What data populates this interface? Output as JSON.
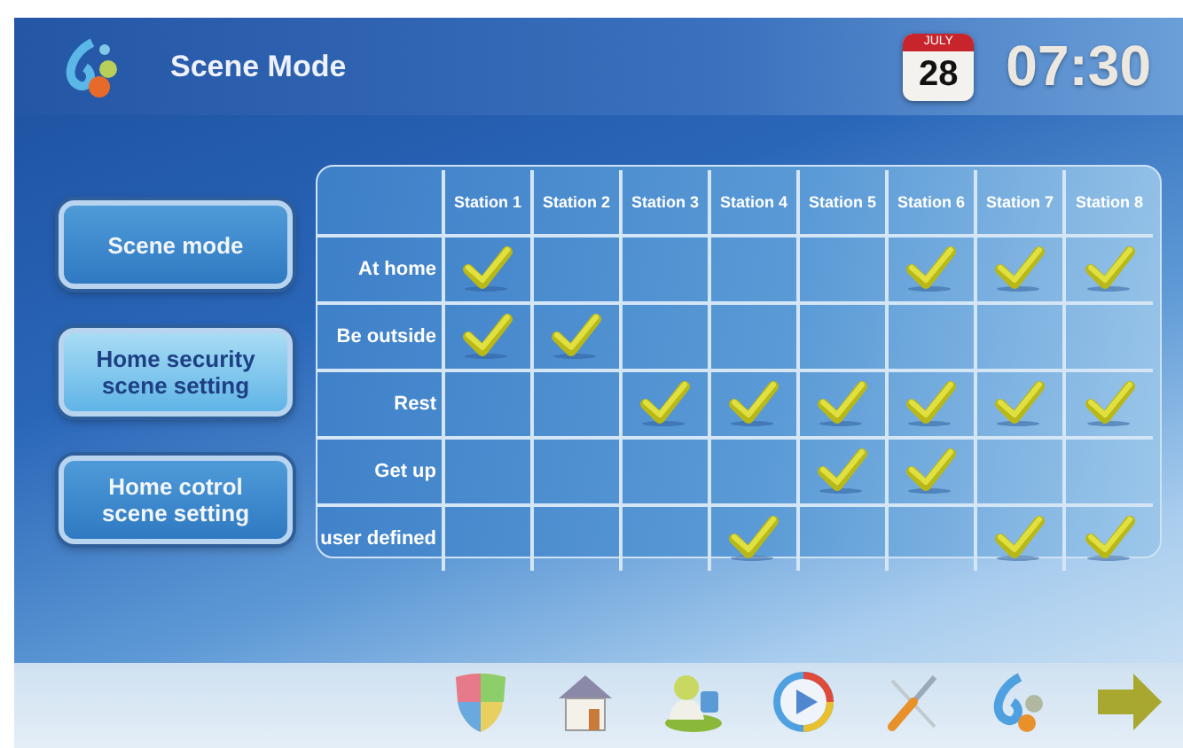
{
  "header": {
    "title": "Scene Mode",
    "date": {
      "month": "JULY",
      "day": "28"
    },
    "time": "07:30"
  },
  "menu": [
    {
      "label": "Scene mode",
      "selected": false
    },
    {
      "label": "Home security scene setting",
      "selected": true
    },
    {
      "label": "Home cotrol scene setting",
      "selected": false
    }
  ],
  "table": {
    "columns": [
      "Station 1",
      "Station 2",
      "Station 3",
      "Station 4",
      "Station 5",
      "Station 6",
      "Station 7",
      "Station 8"
    ],
    "rows": [
      {
        "label": "At home",
        "checks": [
          true,
          false,
          false,
          false,
          false,
          true,
          true,
          true
        ]
      },
      {
        "label": "Be outside",
        "checks": [
          true,
          true,
          false,
          false,
          false,
          false,
          false,
          false
        ]
      },
      {
        "label": "Rest",
        "checks": [
          false,
          false,
          true,
          true,
          true,
          true,
          true,
          true
        ]
      },
      {
        "label": "Get up",
        "checks": [
          false,
          false,
          false,
          false,
          true,
          true,
          false,
          false
        ]
      },
      {
        "label": "user defined",
        "checks": [
          false,
          false,
          false,
          true,
          false,
          false,
          true,
          true
        ]
      }
    ]
  }
}
